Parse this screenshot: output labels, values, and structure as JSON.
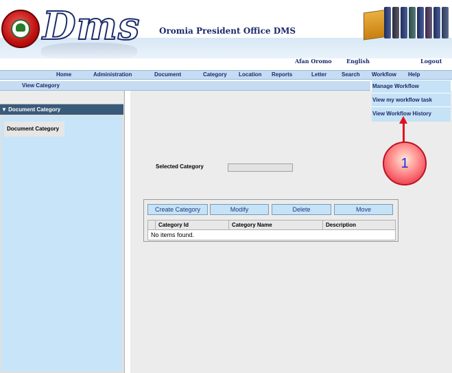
{
  "header": {
    "logo_text": "Dms",
    "title": "Oromia President Office DMS"
  },
  "top_links": {
    "afan_oromo": "Afan Oromo",
    "english": "English",
    "logout": "Logout"
  },
  "menu": {
    "items": [
      "Home",
      "Administration",
      "Document",
      "Category",
      "Location",
      "Reports",
      "Letter",
      "Search",
      "Workflow",
      "Help"
    ]
  },
  "breadcrumb": "View Category",
  "workflow_dropdown": {
    "items": [
      "Manage Workflow",
      "View my workflow task",
      "View Workflow History"
    ]
  },
  "sidebar": {
    "header": "▼ Document Category",
    "item": "Document Category"
  },
  "main": {
    "selected_category_label": "Selected Category",
    "selected_category_value": "",
    "buttons": {
      "create": "Create Category",
      "modify": "Modify",
      "delete": "Delete",
      "move": "Move"
    },
    "table": {
      "columns": [
        "Category Id",
        "Category Name",
        "Description"
      ],
      "empty_message": "No items found."
    }
  },
  "annotation": {
    "number": "1"
  },
  "colors": {
    "menu_bg": "#c6dcf2",
    "sidebar_header": "#3a5a7a",
    "button_bg": "#c6e2f6",
    "callout_red": "#e01020"
  }
}
